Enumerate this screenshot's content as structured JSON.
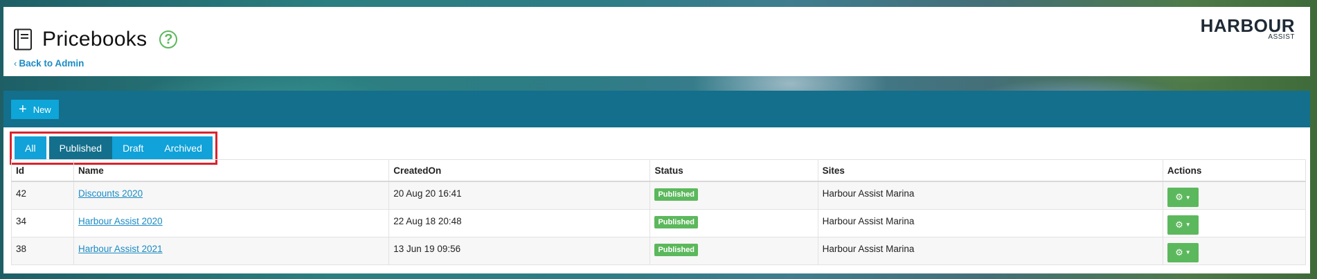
{
  "header": {
    "title": "Pricebooks",
    "back_link": "Back to Admin",
    "help": "?",
    "logo_main": "HARBOUR",
    "logo_sub": "ASSIST"
  },
  "toolbar": {
    "new_label": "New"
  },
  "filters": {
    "tabs": [
      "All",
      "Published",
      "Draft",
      "Archived"
    ],
    "active": "Published"
  },
  "table": {
    "columns": [
      "Id",
      "Name",
      "CreatedOn",
      "Status",
      "Sites",
      "Actions"
    ],
    "rows": [
      {
        "id": "42",
        "name": "Discounts 2020",
        "created_on": "20 Aug 20 16:41",
        "status": "Published",
        "sites": "Harbour Assist Marina"
      },
      {
        "id": "34",
        "name": "Harbour Assist 2020",
        "created_on": "22 Aug 18 20:48",
        "status": "Published",
        "sites": "Harbour Assist Marina"
      },
      {
        "id": "38",
        "name": "Harbour Assist 2021",
        "created_on": "13 Jun 19 09:56",
        "status": "Published",
        "sites": "Harbour Assist Marina"
      }
    ]
  },
  "colors": {
    "toolbar": "#136f8c",
    "accent_blue": "#10a2d8",
    "success_green": "#5cb85c",
    "highlight_red": "#d9232d"
  },
  "icons": {
    "title": "book-icon",
    "help": "question-circle-icon",
    "back": "chevron-left-icon",
    "new": "plus-icon",
    "action": "gear-icon"
  }
}
